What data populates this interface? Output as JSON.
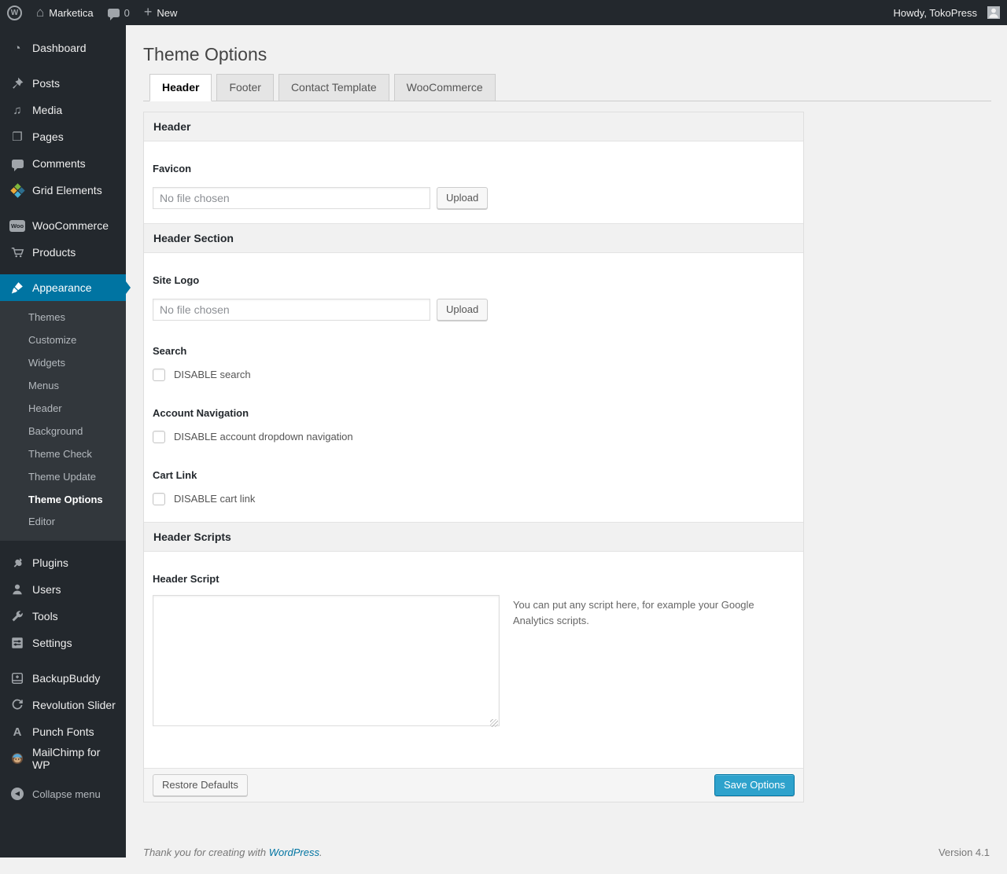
{
  "admin_bar": {
    "site_name": "Marketica",
    "comment_count": "0",
    "new_label": "New",
    "howdy_text": "Howdy, TokoPress"
  },
  "sidebar": {
    "top_items": [
      {
        "label": "Dashboard"
      },
      {
        "label": "Posts"
      },
      {
        "label": "Media"
      },
      {
        "label": "Pages"
      },
      {
        "label": "Comments"
      },
      {
        "label": "Grid Elements"
      },
      {
        "label": "WooCommerce"
      },
      {
        "label": "Products"
      }
    ],
    "appearance_label": "Appearance",
    "appearance_submenu": [
      {
        "label": "Themes"
      },
      {
        "label": "Customize"
      },
      {
        "label": "Widgets"
      },
      {
        "label": "Menus"
      },
      {
        "label": "Header"
      },
      {
        "label": "Background"
      },
      {
        "label": "Theme Check"
      },
      {
        "label": "Theme Update"
      },
      {
        "label": "Theme Options",
        "current": true
      },
      {
        "label": "Editor"
      }
    ],
    "bottom_items": [
      {
        "label": "Plugins"
      },
      {
        "label": "Users"
      },
      {
        "label": "Tools"
      },
      {
        "label": "Settings"
      },
      {
        "label": "BackupBuddy"
      },
      {
        "label": "Revolution Slider"
      },
      {
        "label": "Punch Fonts"
      },
      {
        "label": "MailChimp for WP"
      }
    ],
    "collapse_label": "Collapse menu"
  },
  "page": {
    "title": "Theme Options",
    "tabs": [
      {
        "label": "Header",
        "active": true
      },
      {
        "label": "Footer",
        "active": false
      },
      {
        "label": "Contact Template",
        "active": false
      },
      {
        "label": "WooCommerce",
        "active": false
      }
    ]
  },
  "panel": {
    "section_header": "Header",
    "favicon_label": "Favicon",
    "favicon_placeholder": "No file chosen",
    "favicon_upload": "Upload",
    "header_section_title": "Header Section",
    "site_logo_label": "Site Logo",
    "site_logo_placeholder": "No file chosen",
    "site_logo_upload": "Upload",
    "search_label": "Search",
    "search_checkbox_label": "DISABLE search",
    "account_nav_label": "Account Navigation",
    "account_nav_checkbox_label": "DISABLE account dropdown navigation",
    "cart_link_label": "Cart Link",
    "cart_link_checkbox_label": "DISABLE cart link",
    "header_scripts_title": "Header Scripts",
    "header_script_label": "Header Script",
    "header_script_value": "",
    "header_script_help": "You can put any script here, for example your Google Analytics scripts.",
    "restore_button": "Restore Defaults",
    "save_button": "Save Options"
  },
  "page_footer": {
    "thanks_text": "Thank you for creating with ",
    "thanks_link": "WordPress",
    "thanks_period": ".",
    "version": "Version 4.1"
  },
  "colors": {
    "admin_dark": "#23282d",
    "submenu_dark": "#32373c",
    "highlight_blue": "#0074a2",
    "primary_button_blue": "#2ea2cc",
    "content_background": "#f1f1f1"
  }
}
